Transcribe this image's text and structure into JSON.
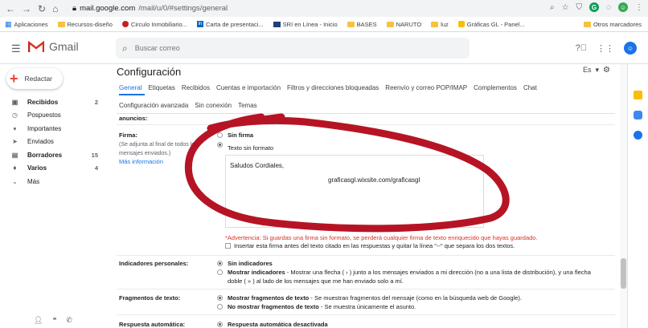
{
  "browser": {
    "url_host": "mail.google.com",
    "url_path": "/mail/u/0/#settings/general"
  },
  "bookmarks": [
    {
      "label": "Aplicaciones"
    },
    {
      "label": "Recursos-diseño"
    },
    {
      "label": "Circulo Inmobiliario..."
    },
    {
      "label": "Carta de presentaci..."
    },
    {
      "label": "SRI en Línea - Inicio"
    },
    {
      "label": "BASES"
    },
    {
      "label": "NARUTO"
    },
    {
      "label": "luz"
    },
    {
      "label": "Gráficas GL - Panel..."
    }
  ],
  "bookmarks_other": "Otros marcadores",
  "header": {
    "app_name": "Gmail",
    "search_placeholder": "Buscar correo"
  },
  "sidebar": {
    "compose_label": "Redactar",
    "items": [
      {
        "label": "Recibidos",
        "count": "2",
        "icon": "inbox-icon"
      },
      {
        "label": "Pospuestos",
        "count": "",
        "icon": "clock-icon"
      },
      {
        "label": "Importantes",
        "count": "",
        "icon": "label-icon"
      },
      {
        "label": "Enviados",
        "count": "",
        "icon": "send-icon"
      },
      {
        "label": "Borradores",
        "count": "15",
        "icon": "draft-icon"
      },
      {
        "label": "Varios",
        "count": "4",
        "icon": "label-icon"
      },
      {
        "label": "Más",
        "count": "",
        "icon": "chevron-down-icon"
      }
    ]
  },
  "settings": {
    "title": "Configuración",
    "lang": "Es",
    "tabs_row1": [
      "General",
      "Etiquetas",
      "Recibidos",
      "Cuentas e importación",
      "Filtros y direcciones bloqueadas",
      "Reenvío y correo POP/IMAP",
      "Complementos",
      "Chat"
    ],
    "tabs_row2": [
      "Configuración avanzada",
      "Sin conexión",
      "Temas"
    ],
    "prev_label": "anuncios:",
    "firma": {
      "label": "Firma:",
      "desc": "(Se adjunta al final de todos los mensajes enviados.)",
      "link": "Más información",
      "opt_none": "Sin firma",
      "opt_text": "Texto sin formato",
      "line1": "Saludos Cordiales,",
      "line2": "graficasgl.wixsite.com/graficasgl",
      "warning": "*Advertencia: Si guardas una firma sin formato, se perderá cualquier firma de texto enriquecido que hayas guardado.",
      "checkbox": "Insertar esta firma antes del texto citado en las respuestas y quitar la línea \"--\" que separa los dos textos."
    },
    "indicadores": {
      "label": "Indicadores personales:",
      "opt1": "Sin indicadores",
      "opt2_bold": "Mostrar indicadores",
      "opt2_rest": " - Mostrar una flecha ( › ) junto a los mensajes enviados a mi dirección (no a una lista de distribución), y una flecha",
      "opt2_line2": "doble ( » ) al lado de los mensajes que me han enviado solo a mí."
    },
    "fragmentos": {
      "label": "Fragmentos de texto:",
      "opt1_bold": "Mostrar fragmentos de texto",
      "opt1_rest": " - Se muestran fragmentos del mensaje (como en la búsqueda web de Google).",
      "opt2_bold": "No mostrar fragmentos de texto",
      "opt2_rest": " - Se muestra únicamente el asunto."
    },
    "respuesta": {
      "label": "Respuesta automática:",
      "opt1": "Respuesta automática desactivada"
    }
  },
  "colors": {
    "accent": "#1a73e8",
    "scribble": "#b00012",
    "warning": "#d93025"
  }
}
